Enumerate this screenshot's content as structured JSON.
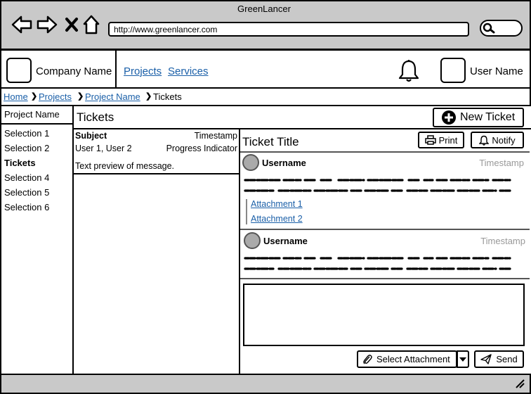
{
  "window": {
    "title": "GreenLancer",
    "url": "http://www.greenlancer.com"
  },
  "header": {
    "company_name": "Company Name",
    "nav": [
      "Projects",
      "Services"
    ],
    "user_name": "User Name"
  },
  "breadcrumb": {
    "home": "Home",
    "projects": "Projects",
    "project_name": "Project Name",
    "current": "Tickets"
  },
  "sidebar": {
    "title": "Project Name",
    "items": [
      "Selection 1",
      "Selection 2",
      "Tickets",
      "Selection 4",
      "Selection 5",
      "Selection 6"
    ],
    "active_index": 2
  },
  "tickets": {
    "title": "Tickets",
    "new_ticket_label": "New Ticket",
    "list": [
      {
        "subject": "Subject",
        "timestamp": "Timestamp",
        "users": "User 1, User 2",
        "progress": "Progress Indicator",
        "preview": "Text preview of message."
      }
    ]
  },
  "detail": {
    "title": "Ticket Title",
    "print_label": "Print",
    "notify_label": "Notify",
    "messages": [
      {
        "username": "Username",
        "timestamp": "Timestamp",
        "attachments": [
          "Attachment 1",
          "Attachment 2"
        ]
      },
      {
        "username": "Username",
        "timestamp": "Timestamp",
        "attachments": []
      }
    ],
    "select_attachment_label": "Select Attachment",
    "send_label": "Send"
  },
  "icons": {
    "back": "back-arrow-icon",
    "forward": "forward-arrow-icon",
    "stop": "close-icon",
    "home": "home-icon",
    "search": "search-icon",
    "bell": "bell-icon",
    "plus": "plus-circle-icon",
    "print": "printer-icon",
    "notify": "bell-icon",
    "paperclip": "paperclip-icon",
    "send": "paper-plane-icon",
    "dropdown": "caret-down-icon",
    "resize": "resize-grip-icon"
  },
  "colors": {
    "chrome": "#c9c9c9",
    "link": "#1a5fa8",
    "muted": "#999999"
  }
}
